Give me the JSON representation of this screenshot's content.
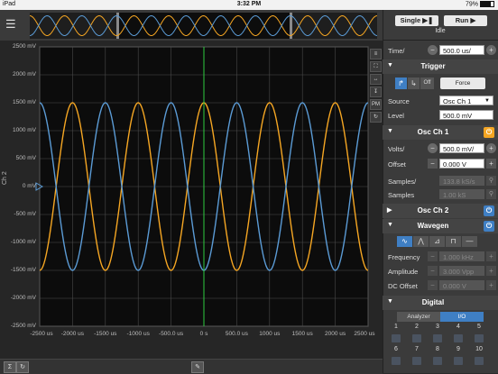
{
  "status": {
    "device": "iPad",
    "time": "3:32 PM",
    "battery": "79%"
  },
  "plot": {
    "channel_label": "Ch 2",
    "y_ticks": [
      "2500 mV",
      "2000 mV",
      "1500 mV",
      "1000 mV",
      "500 mV",
      "0 mV",
      "-500 mV",
      "-1000 mV",
      "-1500 mV",
      "-2000 mV",
      "-2500 mV"
    ],
    "x_ticks": [
      "-2500 us",
      "-2000 us",
      "-1500 us",
      "-1000 us",
      "-500.0 us",
      "0 s",
      "500.0 us",
      "1000 us",
      "1500 us",
      "2000 us",
      "2500 us"
    ],
    "side_icon_pm": "PM",
    "colors": {
      "ch1": "#f5a623",
      "ch2": "#5b9bd5",
      "trigger": "#2ecc40",
      "grid": "#4a4a4a"
    }
  },
  "chart_data": {
    "type": "line",
    "xlabel": "",
    "ylabel": "Ch 2",
    "xlim": [
      -2500,
      2500
    ],
    "ylim": [
      -2500,
      2500
    ],
    "grid": true,
    "series": [
      {
        "color": "#f5a623",
        "amplitude": 1500,
        "period": 1000,
        "phase_deg": 0
      },
      {
        "color": "#5b9bd5",
        "amplitude": 1500,
        "period": 1000,
        "phase_deg": 180
      }
    ]
  },
  "controls": {
    "single_label": "Single",
    "run_label": "Run",
    "state_label": "Idle",
    "time_label": "Time/",
    "time_value": "500.0 us/"
  },
  "trigger": {
    "title": "Trigger",
    "off_label": "Off",
    "force_label": "Force",
    "source_label": "Source",
    "source_value": "Osc Ch 1",
    "level_label": "Level",
    "level_value": "500.0 mV"
  },
  "osc1": {
    "title": "Osc Ch 1",
    "volts_label": "Volts/",
    "volts_value": "500.0 mV/",
    "offset_label": "Offset",
    "offset_value": "0.000 V",
    "samples_rate_label": "Samples/",
    "samples_rate_value": "133.8 kS/s",
    "samples_label": "Samples",
    "samples_value": "1.00 kS"
  },
  "osc2": {
    "title": "Osc Ch 2"
  },
  "wavegen": {
    "title": "Wavegen",
    "frequency_label": "Frequency",
    "frequency_value": "1.000 kHz",
    "amplitude_label": "Amplitude",
    "amplitude_value": "3.000 Vpp",
    "dc_offset_label": "DC Offset",
    "dc_offset_value": "0.000 V"
  },
  "digital": {
    "title": "Digital",
    "analyzer_label": "Analyzer",
    "io_label": "I/O",
    "pins_row1": [
      "1",
      "2",
      "3",
      "4",
      "5"
    ],
    "pins_row2": [
      "6",
      "7",
      "8",
      "9",
      "10"
    ]
  }
}
